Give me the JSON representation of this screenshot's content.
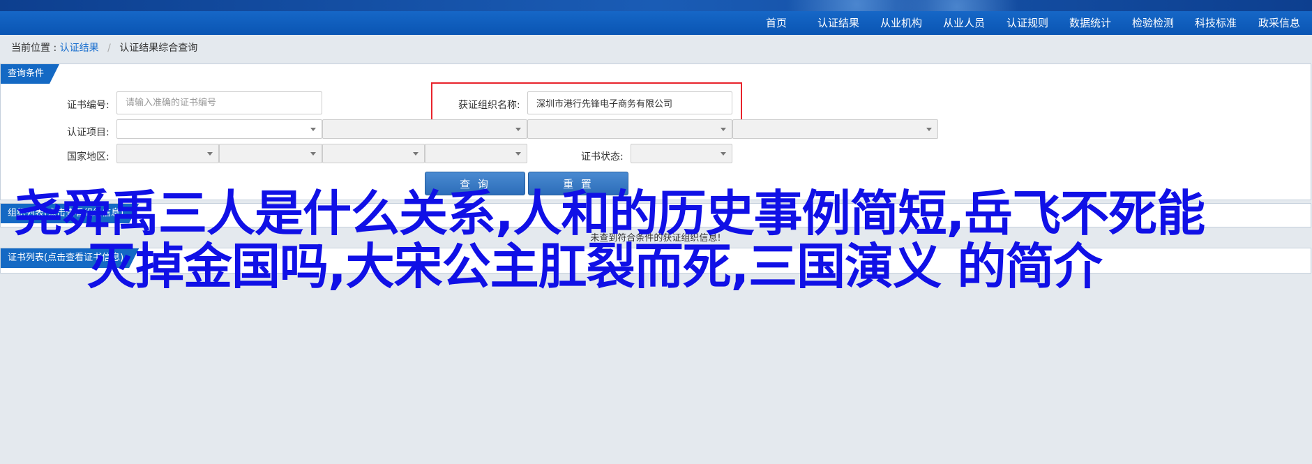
{
  "nav": {
    "items": [
      {
        "label": "首页"
      },
      {
        "label": "认证结果"
      },
      {
        "label": "从业机构"
      },
      {
        "label": "从业人员"
      },
      {
        "label": "认证规则"
      },
      {
        "label": "数据统计"
      },
      {
        "label": "检验检测"
      },
      {
        "label": "科技标准"
      },
      {
        "label": "政采信息"
      }
    ]
  },
  "breadcrumb": {
    "prefix": "当前位置 :",
    "link": "认证结果",
    "separator": "/",
    "current": "认证结果综合查询"
  },
  "query_panel": {
    "tab": "查询条件",
    "cert_number": {
      "label": "证书编号:",
      "placeholder": "请输入准确的证书编号",
      "value": ""
    },
    "org_name": {
      "label": "获证组织名称:",
      "value": "深圳市港行先锋电子商务有限公司"
    },
    "cert_item": {
      "label": "认证项目:"
    },
    "region": {
      "label": "国家地区:"
    },
    "cert_status": {
      "label": "证书状态:"
    },
    "search_button": "查 询",
    "reset_button": "重 置"
  },
  "org_list_panel": {
    "tab": "组织列表(点击查看组织信息)",
    "empty_message": "未查到符合条件的获证组织信息!"
  },
  "cert_list_panel": {
    "tab": "证书列表(点击查看证书信息)"
  },
  "overlay_text": {
    "line1": "尧舜禹三人是什么关系,人和的历史事例简短,岳飞不死能",
    "line2": "灭掉金国吗,大宋公主肛裂而死,三国演义 的简介"
  },
  "colors": {
    "nav_bg": "#0a55b3",
    "tab_bg": "#1469c4",
    "button_bg": "#2c6db9",
    "highlight": "#e8242c",
    "overlay_text": "#1010e6"
  }
}
